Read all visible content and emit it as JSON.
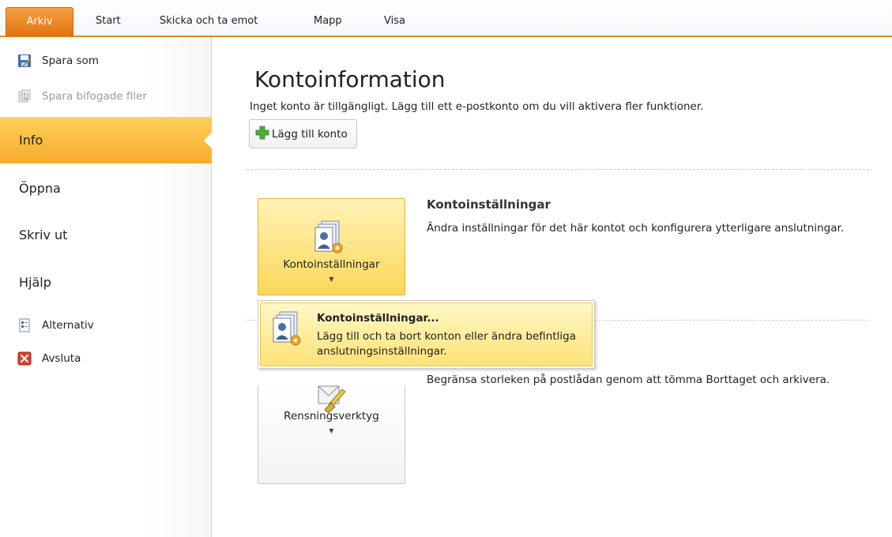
{
  "tabs": {
    "file": "Arkiv",
    "start": "Start",
    "send_receive": "Skicka och ta emot",
    "folder": "Mapp",
    "view": "Visa"
  },
  "left_nav": {
    "save_as": "Spara som",
    "save_attachments": "Spara bifogade filer",
    "info": "Info",
    "open": "Öppna",
    "print": "Skriv ut",
    "help": "Hjälp",
    "options": "Alternativ",
    "exit": "Avsluta"
  },
  "main": {
    "title": "Kontoinformation",
    "subtitle": "Inget konto är tillgängligt. Lägg till ett e-postkonto om du vill aktivera fler funktioner.",
    "add_account": "Lägg till konto",
    "account_settings_button": "Kontoinställningar",
    "account_settings_title": "Kontoinställningar",
    "account_settings_desc": "Ändra inställningar för det här kontot och konfigurera ytterligare anslutningar.",
    "cleanup_button": "Rensningsverktyg",
    "cleanup_desc": "Begränsa storleken på postlådan genom att tömma Borttaget och arkivera."
  },
  "dropdown": {
    "item_title": "Kontoinställningar...",
    "item_desc": "Lägg till och ta bort konton eller ändra befintliga anslutningsinställningar."
  },
  "colors": {
    "file_tab": "#e47a14",
    "active_nav": "#f8b632",
    "hot_button": "#fbd75a"
  }
}
